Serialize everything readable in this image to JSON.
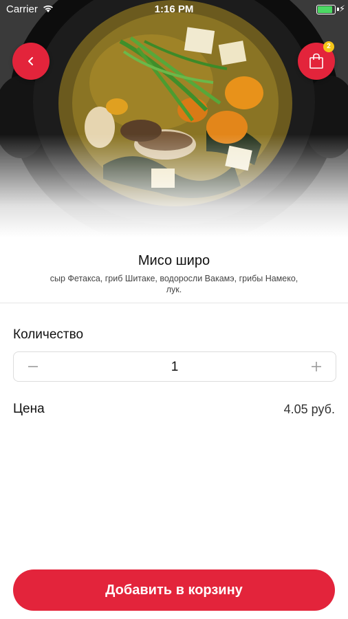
{
  "status_bar": {
    "carrier": "Carrier",
    "time": "1:16 PM",
    "battery_level": 1.0
  },
  "header": {
    "back_icon": "chevron-left-icon",
    "cart_icon": "shopping-bag-icon",
    "cart_badge": "2"
  },
  "product": {
    "title": "Мисо широ",
    "description": "сыр Фетакса, гриб Шитаке, водоросли Вакамэ, грибы Намеко, лук."
  },
  "quantity": {
    "label": "Количество",
    "value": "1",
    "minus_icon": "minus-icon",
    "plus_icon": "plus-icon"
  },
  "price": {
    "label": "Цена",
    "value": "4.05 руб."
  },
  "cta": {
    "label": "Добавить в корзину"
  },
  "colors": {
    "accent": "#e3243b",
    "badge": "#f5c518"
  }
}
